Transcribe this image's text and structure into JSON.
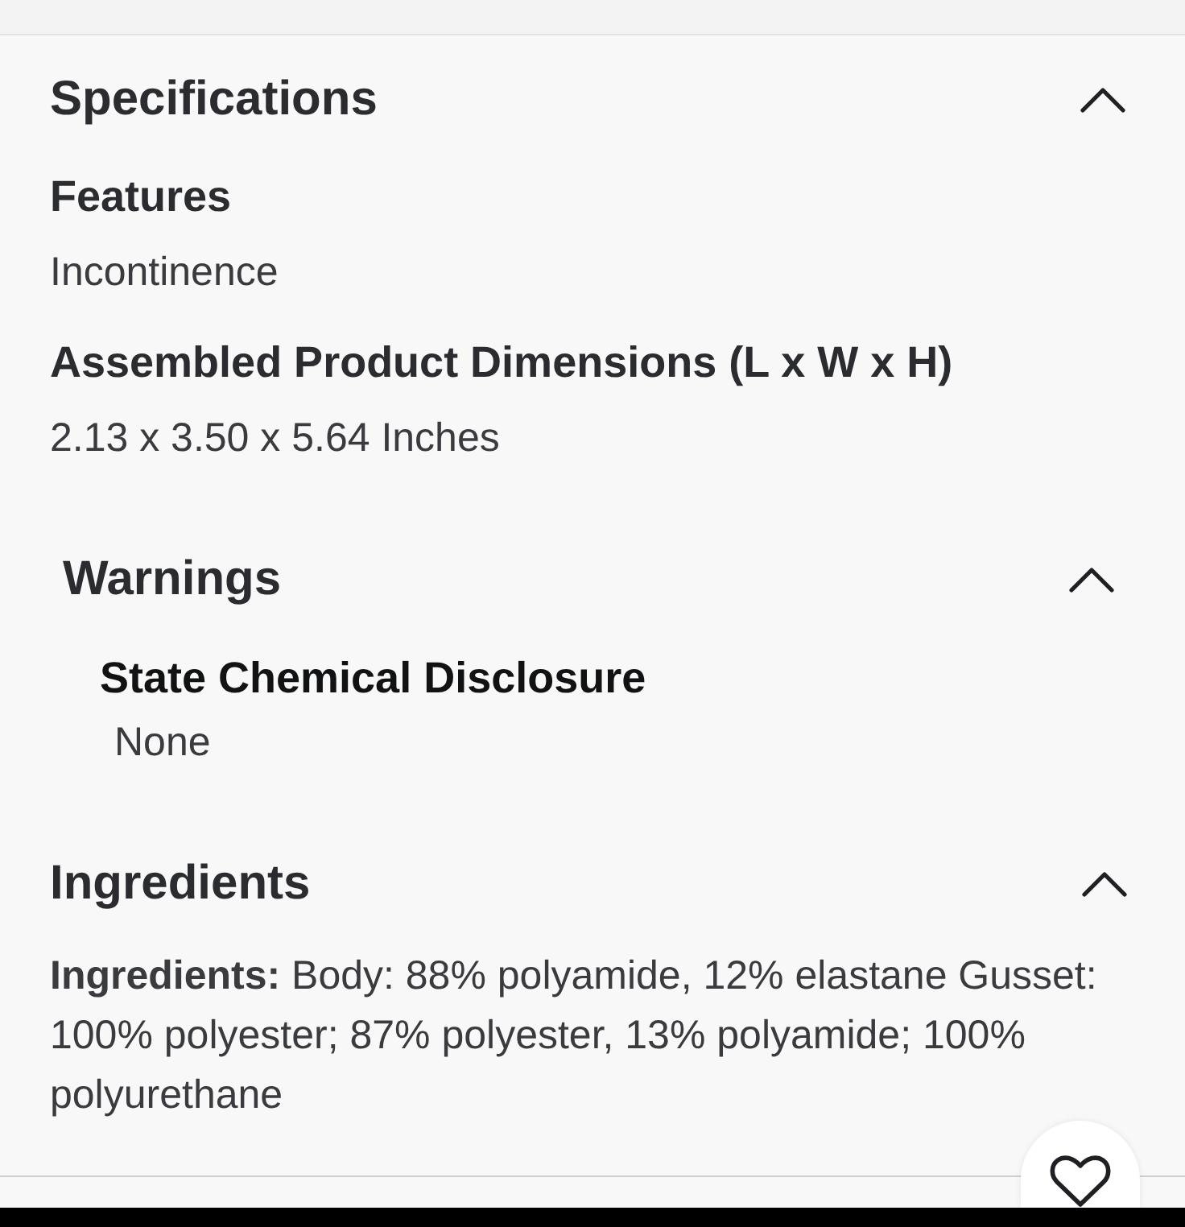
{
  "sections": [
    {
      "title": "Specifications",
      "expanded": true,
      "kind": "specs",
      "items": [
        {
          "label": "Features",
          "value": "Incontinence"
        },
        {
          "label": "Assembled Product Dimensions (L x W x H)",
          "value": "2.13 x 3.50 x 5.64 Inches"
        }
      ]
    },
    {
      "title": "Warnings",
      "expanded": true,
      "kind": "warnings",
      "items": [
        {
          "label": "State Chemical Disclosure",
          "value": "None"
        }
      ]
    },
    {
      "title": "Ingredients",
      "expanded": true,
      "kind": "text",
      "text": "**Ingredients:** Body: 88% polyamide, 12% elastane Gusset: 100% polyester; 87% polyester, 13% polyamide; 100% polyurethane"
    }
  ],
  "favorite_button": {
    "favorited": false
  }
}
